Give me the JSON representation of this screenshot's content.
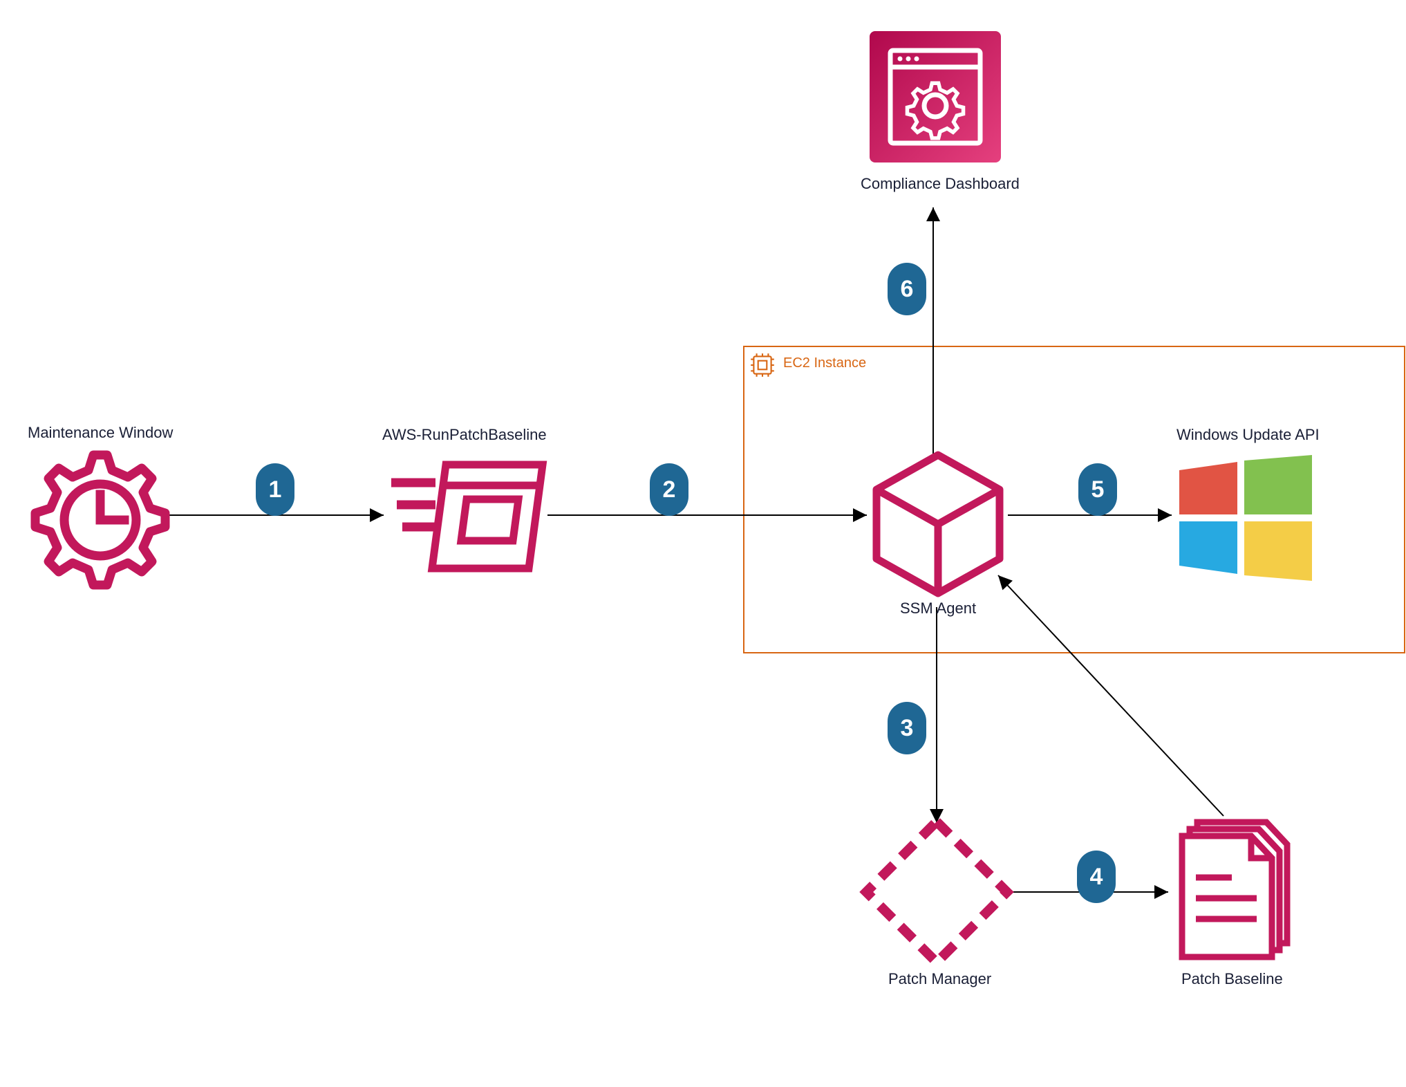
{
  "diagram": {
    "nodes": {
      "maintenance_window": {
        "label": "Maintenance Window"
      },
      "run_patch_baseline": {
        "label": "AWS-RunPatchBaseline"
      },
      "compliance_dashboard": {
        "label": "Compliance Dashboard"
      },
      "ec2_container": {
        "label": "EC2 Instance"
      },
      "ssm_agent": {
        "label": "SSM  Agent"
      },
      "windows_update_api": {
        "label": "Windows Update API"
      },
      "patch_manager": {
        "label": "Patch Manager"
      },
      "patch_baseline": {
        "label": "Patch Baseline"
      }
    },
    "steps": {
      "s1": "1",
      "s2": "2",
      "s3": "3",
      "s4": "4",
      "s5": "5",
      "s6": "6"
    },
    "colors": {
      "crimson": "#c2185b",
      "orange": "#d86613",
      "badge": "#1f6794",
      "win_red": "#e15444",
      "win_green": "#82c14f",
      "win_blue": "#27a9e1",
      "win_yellow": "#f4cd47",
      "dash_grad_a": "#b0084c",
      "dash_grad_b": "#e5407e"
    },
    "flow": [
      {
        "from": "maintenance_window",
        "to": "run_patch_baseline",
        "step": 1
      },
      {
        "from": "run_patch_baseline",
        "to": "ssm_agent",
        "step": 2
      },
      {
        "from": "ssm_agent",
        "to": "patch_manager",
        "step": 3
      },
      {
        "from": "patch_manager",
        "to": "patch_baseline",
        "step": 4
      },
      {
        "from": "patch_baseline",
        "to": "ssm_agent",
        "step": null
      },
      {
        "from": "ssm_agent",
        "to": "windows_update_api",
        "step": 5
      },
      {
        "from": "ssm_agent",
        "to": "compliance_dashboard",
        "step": 6
      }
    ]
  }
}
